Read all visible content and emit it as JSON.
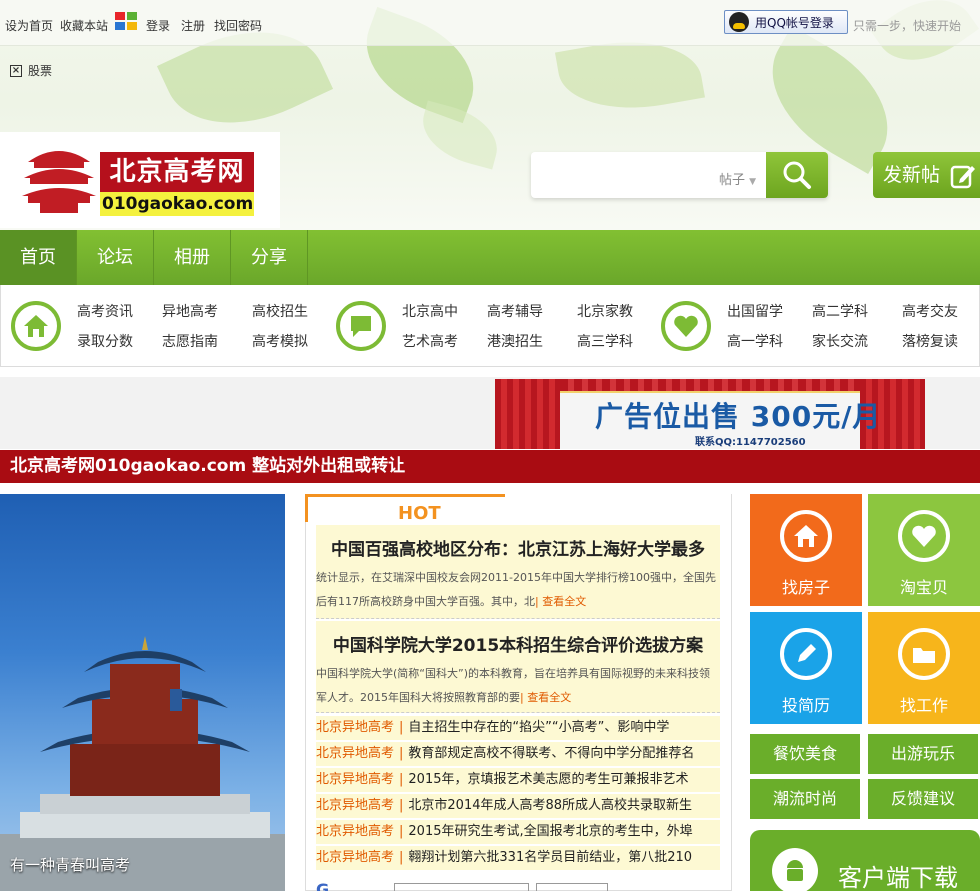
{
  "topbar": {
    "set_home": "设为首页",
    "bookmark": "收藏本站",
    "login": "登录",
    "register": "注册",
    "recover": "找回密码",
    "qq_login": "用QQ帐号登录",
    "qq_tip": "只需一步，快速开始"
  },
  "stocks": {
    "label": "股票"
  },
  "logo": {
    "name": "北京高考网",
    "domain": "010gaokao.com"
  },
  "search": {
    "type": "帖子",
    "placeholder": ""
  },
  "post_button": "发新帖",
  "nav": [
    "首页",
    "论坛",
    "相册",
    "分享"
  ],
  "quick": {
    "group1": [
      "高考资讯",
      "异地高考",
      "高校招生",
      "录取分数",
      "志愿指南",
      "高考模拟"
    ],
    "group2": [
      "北京高中",
      "高考辅导",
      "北京家教",
      "艺术高考",
      "港澳招生",
      "高三学科"
    ],
    "group3": [
      "出国留学",
      "高二学科",
      "高考交友",
      "高一学科",
      "家长交流",
      "落榜复读"
    ]
  },
  "ad": {
    "text": "广告位出售 300元/月",
    "contact": "联系QQ:1147702560"
  },
  "banner": "北京高考网010gaokao.com 整站对外出租或转让",
  "photo": {
    "caption": "有一种青春叫高考"
  },
  "news": {
    "hot_label": "HOT",
    "featured": [
      {
        "title": "中国百强高校地区分布：北京江苏上海好大学最多",
        "summary": "统计显示，在艾瑞深中国校友会网2011-2015年中国大学排行榜100强中，全国先后有117所高校跻身中国大学百强。其中，北",
        "more": "| 查看全文"
      },
      {
        "title": "中国科学院大学2015本科招生综合评价选拔方案",
        "summary": "中国科学院大学(简称“国科大”)的本科教育，旨在培养具有国际视野的未来科技领军人才。2015年国科大将按照教育部的要",
        "more": "| 查看全文"
      }
    ],
    "items": [
      {
        "category": "北京异地高考",
        "title": "自主招生中存在的“掐尖”“小高考”、影响中学"
      },
      {
        "category": "北京异地高考",
        "title": "教育部规定高校不得联考、不得向中学分配推荐名"
      },
      {
        "category": "北京异地高考",
        "title": "2015年，京填报艺术美志愿的考生可兼报非艺术"
      },
      {
        "category": "北京异地高考",
        "title": "北京市2014年成人高考88所成人高校共录取新生"
      },
      {
        "category": "北京异地高考",
        "title": "2015年研究生考试,全国报考北京的考生中，外埠"
      },
      {
        "category": "北京异地高考",
        "title": "翱翔计划第六批331名学员目前结业，第八批210"
      }
    ]
  },
  "tiles": [
    "找房子",
    "淘宝贝",
    "投简历",
    "找工作"
  ],
  "green_tiles": [
    "餐饮美食",
    "出游玩乐",
    "潮流时尚",
    "反馈建议"
  ],
  "client_download": "客户端下载",
  "colors": {
    "nav_green": "#6aa72a",
    "banner_red": "#a90c12",
    "orange": "#f26a1b",
    "light_green": "#8cc63f",
    "blue": "#1aa3e8",
    "yellow": "#f7b51b",
    "hot_orange": "#f39220"
  }
}
